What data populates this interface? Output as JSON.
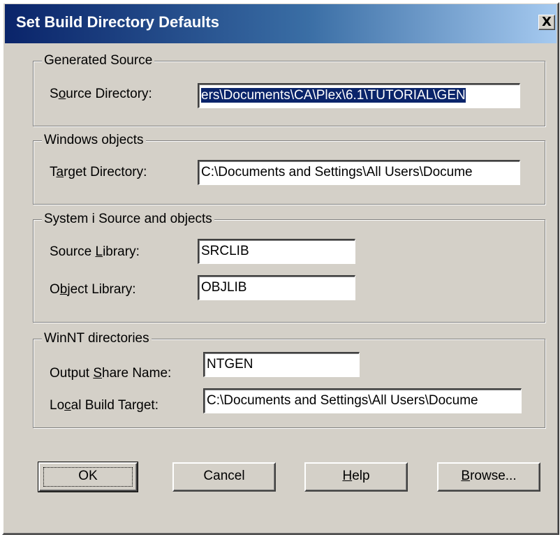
{
  "window": {
    "title": "Set Build Directory Defaults",
    "close_glyph": "X"
  },
  "generated_source": {
    "group_title": "Generated Source",
    "source_directory": {
      "label_pre": "S",
      "label_mnemonic": "o",
      "label_post": "urce Directory:",
      "value": "ers\\Documents\\CA\\Plex\\6.1\\TUTORIAL\\GEN"
    }
  },
  "windows_objects": {
    "group_title": "Windows objects",
    "target_directory": {
      "label_pre": "T",
      "label_mnemonic": "a",
      "label_post": "rget Directory:",
      "value": "C:\\Documents and Settings\\All Users\\Docume"
    }
  },
  "system_i": {
    "group_title": "System i Source and objects",
    "source_library": {
      "label_pre": "Source ",
      "label_mnemonic": "L",
      "label_post": "ibrary:",
      "value": "SRCLIB"
    },
    "object_library": {
      "label_pre": "O",
      "label_mnemonic": "b",
      "label_post": "ject Library:",
      "value": "OBJLIB"
    }
  },
  "winnt": {
    "group_title": "WinNT directories",
    "output_share_name": {
      "label_pre": "Output ",
      "label_mnemonic": "S",
      "label_post": "hare Name:",
      "value": "NTGEN"
    },
    "local_build_target": {
      "label_pre": "Lo",
      "label_mnemonic": "c",
      "label_post": "al Build Target:",
      "value": "C:\\Documents and Settings\\All Users\\Docume"
    }
  },
  "buttons": {
    "ok": "OK",
    "cancel": "Cancel",
    "help_mnemonic": "H",
    "help_rest": "elp",
    "browse_mnemonic": "B",
    "browse_rest": "rowse..."
  },
  "colors": {
    "dialog_face": "#d4d0c8",
    "title_gradient_start": "#0a246a",
    "title_gradient_end": "#a6caf0",
    "selection": "#0a246a"
  }
}
